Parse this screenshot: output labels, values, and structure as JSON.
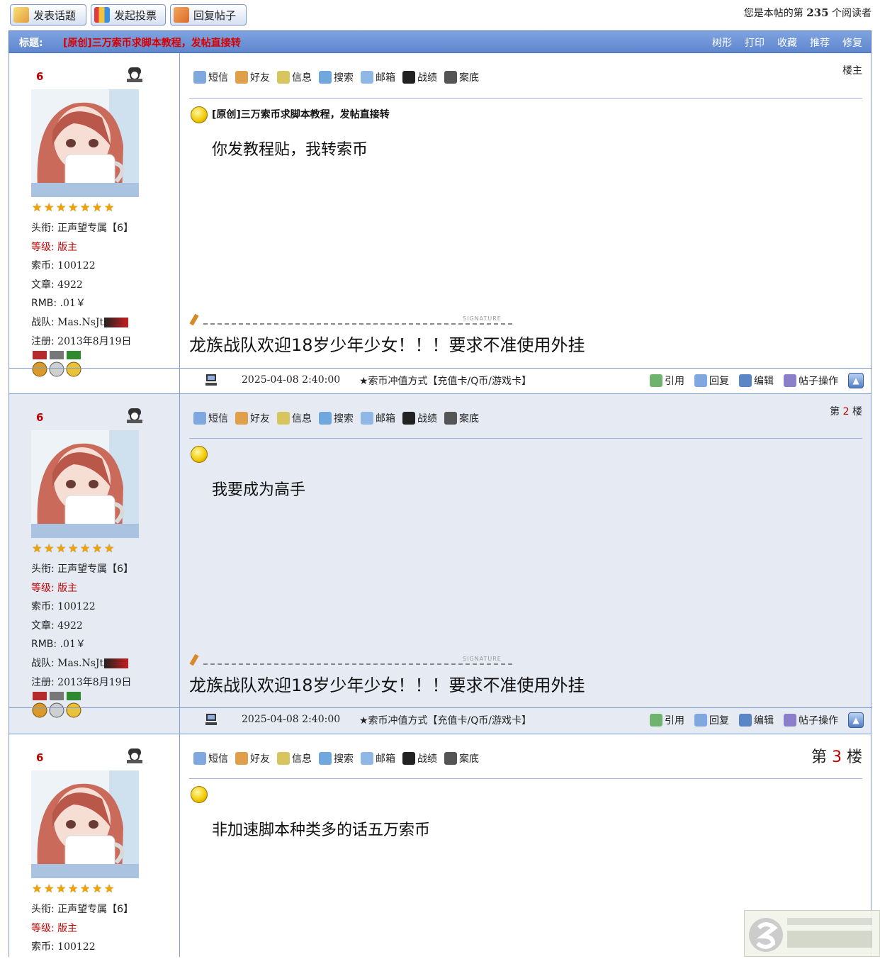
{
  "toolbar": {
    "buttons": [
      "发表话题",
      "发起投票",
      "回复帖子"
    ],
    "readers_prefix": "您是本帖的第",
    "readers_count": "235",
    "readers_suffix": "个阅读者"
  },
  "titlebar": {
    "label": "标题:",
    "title": "[原创]三万索币求脚本教程，发帖直接转",
    "actions": [
      "树形",
      "打印",
      "收藏",
      "推荐",
      "修复"
    ]
  },
  "user": {
    "name": "6",
    "rating": 6.5,
    "rows": {
      "title_label": "头衔:",
      "title_value": "正声望专属【6】",
      "level_label": "等级:",
      "level_value": "版主",
      "coins_label": "索币:",
      "coins_value": "100122",
      "posts_label": "文章:",
      "posts_value": "4922",
      "rmb_label": "RMB:",
      "rmb_value": ".01￥",
      "team_label": "战队:",
      "team_value": "Mas.NsJt",
      "reg_label": "注册:",
      "reg_value": "2013年8月19日"
    }
  },
  "tools": [
    "短信",
    "好友",
    "信息",
    "搜索",
    "邮箱",
    "战绩",
    "案底"
  ],
  "posts": [
    {
      "floor_text": "楼主",
      "title": "[原创]三万索币求脚本教程，发帖直接转",
      "body": "你发教程贴，我转索币",
      "signature_tag": "SIGNATURE",
      "signature": "龙族战队欢迎18岁少年少女！！！要求不准使用外挂",
      "date": "2025-04-08 2:40:00",
      "pay": "★索币冲值方式【充值卡/Q币/游戏卡】"
    },
    {
      "floor_prefix": "第",
      "floor_num": "2",
      "floor_suffix": "楼",
      "body": "我要成为高手",
      "signature_tag": "SIGNATURE",
      "signature": "龙族战队欢迎18岁少年少女！！！要求不准使用外挂",
      "date": "2025-04-08 2:40:00",
      "pay": "★索币冲值方式【充值卡/Q币/游戏卡】"
    },
    {
      "floor_prefix": "第",
      "floor_num": "3",
      "floor_suffix": "楼",
      "body": "非加速脚本种类多的话五万索币"
    }
  ],
  "footer_actions": [
    "引用",
    "回复",
    "编辑",
    "帖子操作"
  ],
  "colors": {
    "accent": "#5f86cf",
    "red": "#c00000",
    "alt_bg": "#e6eaf3",
    "border": "#7f9fd3"
  }
}
